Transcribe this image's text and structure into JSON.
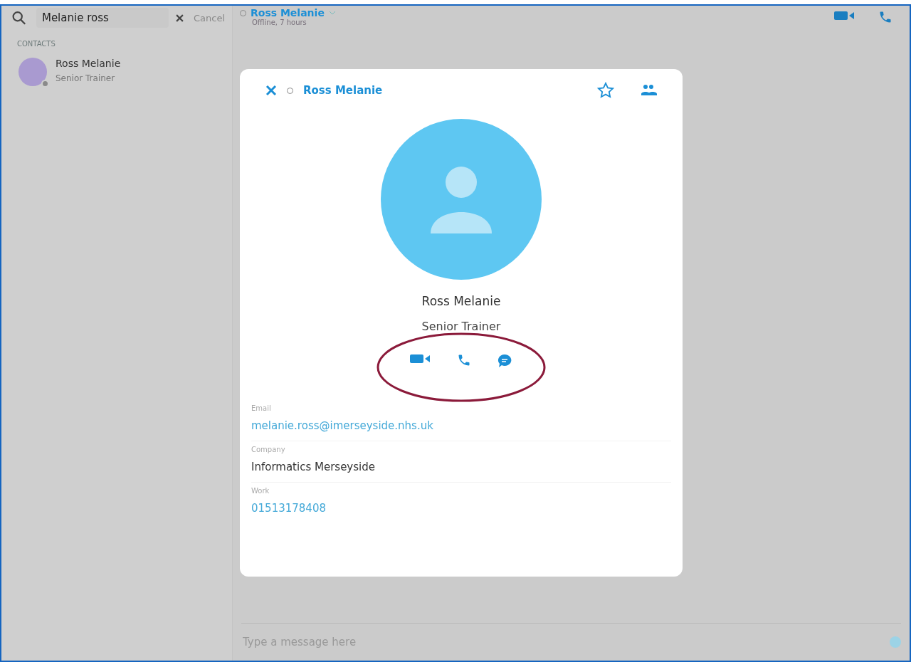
{
  "sidebar": {
    "search": {
      "value": "Melanie ross"
    },
    "cancel": "Cancel",
    "section": "CONTACTS",
    "contacts": [
      {
        "name": "Ross Melanie",
        "subtitle": "Senior Trainer",
        "online": false
      }
    ]
  },
  "header": {
    "name": "Ross Melanie",
    "status": "Offline, 7 hours",
    "online": false
  },
  "profile": {
    "title": "Ross Melanie",
    "online": false,
    "name": "Ross Melanie",
    "role": "Senior Trainer",
    "fields": [
      {
        "label": "Email",
        "value": "melanie.ross@imerseyside.nhs.uk",
        "kind": "link"
      },
      {
        "label": "Company",
        "value": "Informatics Merseyside",
        "kind": "text"
      },
      {
        "label": "Work",
        "value": "01513178408",
        "kind": "link"
      }
    ]
  },
  "composer": {
    "placeholder": "Type a message here"
  }
}
